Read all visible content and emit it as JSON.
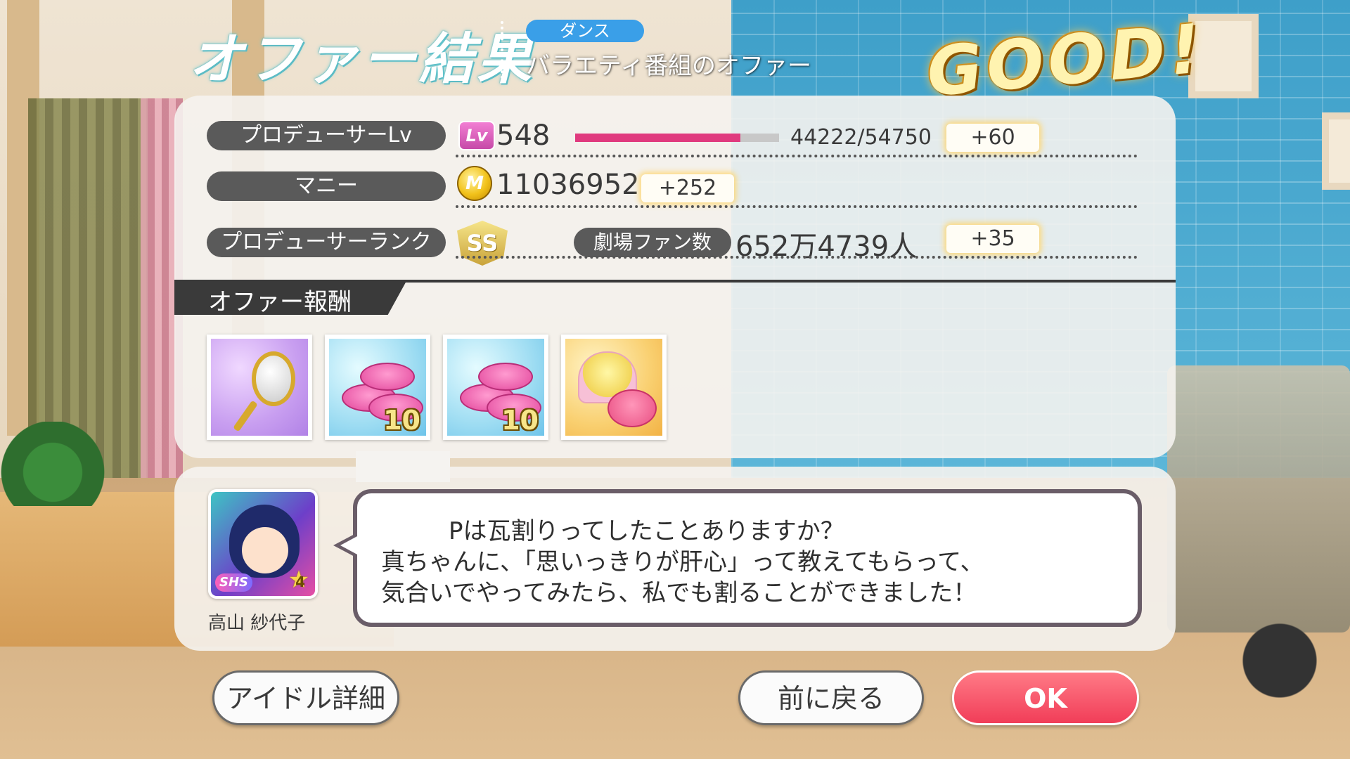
{
  "header": {
    "title": "オファー結果",
    "category": "ダンス",
    "offer_name": "バラエティ番組のオファー",
    "result": "GOOD!"
  },
  "stats": {
    "producer_lv": {
      "label": "プロデューサーLv",
      "icon_text": "Lv",
      "value": "548",
      "exp_text": "44222/54750",
      "exp_progress": 0.81,
      "gain": "+60"
    },
    "money": {
      "label": "マニー",
      "icon_text": "M",
      "value": "11036952",
      "gain": "+252"
    },
    "rank": {
      "label": "プロデューサーランク",
      "rank_text": "SS"
    },
    "fans": {
      "label": "劇場ファン数",
      "value": "652万4739人",
      "gain": "+35"
    }
  },
  "rewards": {
    "header": "オファー報酬",
    "items": [
      {
        "icon": "hand-mirror-icon",
        "qty": ""
      },
      {
        "icon": "pink-coins-icon",
        "qty": "10"
      },
      {
        "icon": "pink-coins-icon",
        "qty": "10"
      },
      {
        "icon": "cream-jar-icon",
        "qty": ""
      }
    ]
  },
  "message": {
    "idol_name": "高山 紗代子",
    "rarity": "SHS",
    "star_level": "4",
    "lines": [
      "Pは瓦割りってしたことありますか？",
      "真ちゃんに、「思いっきりが肝心」って教えてもらって、",
      "気合いでやってみたら、私でも割ることができました！"
    ]
  },
  "buttons": {
    "idol_detail": "アイドル詳細",
    "back": "前に戻る",
    "ok": "OK"
  },
  "colors": {
    "accent_pink": "#e03a7e",
    "ok_button": "#f13d58",
    "category_pill": "#3a9fe8"
  }
}
